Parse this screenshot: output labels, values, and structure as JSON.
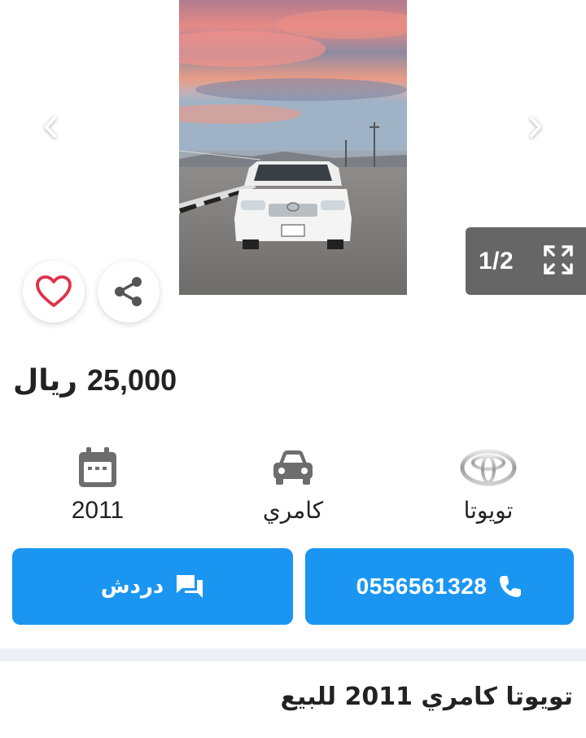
{
  "gallery": {
    "counter": "1/2",
    "prev_icon": "chevron-left-icon",
    "next_icon": "chevron-right-icon",
    "expand_icon": "expand-icon",
    "photo_alt": "photo of white Toyota Camry at sunset"
  },
  "actions": {
    "favorite_icon": "heart-icon",
    "share_icon": "share-icon"
  },
  "price": {
    "value": "25,000",
    "currency": "ريال"
  },
  "specs": {
    "make": {
      "label": "تويوتا",
      "icon": "toyota-logo-icon"
    },
    "model": {
      "label": "كامري",
      "icon": "car-icon"
    },
    "year": {
      "label": "2011",
      "icon": "calendar-icon"
    }
  },
  "buttons": {
    "call_label": "0556561328",
    "call_icon": "phone-icon",
    "chat_label": "دردش",
    "chat_icon": "chat-icon"
  },
  "listing": {
    "title": "تويوتا كامري 2011 للبيع"
  },
  "colors": {
    "accent": "#1a96f2",
    "heart": "#e0314a",
    "counter_bg": "#666666",
    "divider": "#eef0f7"
  }
}
